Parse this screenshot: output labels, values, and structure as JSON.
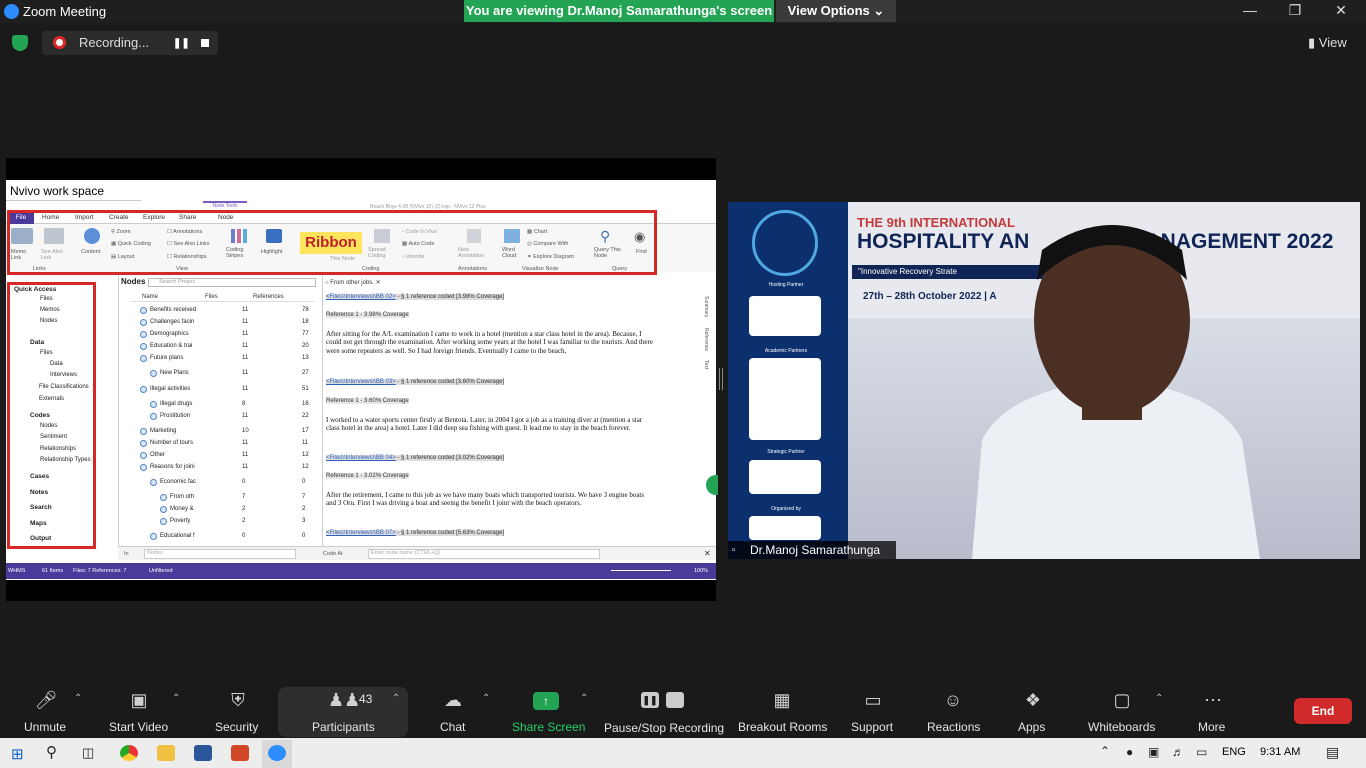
{
  "window": {
    "title": "Zoom Meeting",
    "viewing_banner": "You are viewing Dr.Manoj Samarathunga's screen",
    "view_options": "View Options"
  },
  "recording": {
    "label": "Recording...",
    "view_label": "View"
  },
  "nvivo": {
    "caption": "Nvivo work space",
    "window_title": "Beach Boys 4-28 (NVivo 12) (2).nvp - NVivo 12 Plus",
    "node_tools": "Node Tools",
    "tabs": [
      "File",
      "Home",
      "Import",
      "Create",
      "Explore",
      "Share",
      "Node"
    ],
    "ribbon_word": "Ribbon",
    "ribbon_items": {
      "memo_link": "Memo Link",
      "see_also_link": "See Also Link",
      "content": "Content",
      "zoom": "Zoom",
      "quick_coding": "Quick Coding",
      "layout": "Layout",
      "annotations": "Annotations",
      "see_also_links": "See Also Links",
      "relationships": "Relationships",
      "coding_stripes": "Coding Stripes",
      "highlight": "Highlight",
      "spread_coding": "Spread Coding",
      "code_in_vivo": "Code In Vivo",
      "auto_code": "Auto Code",
      "uncode": "Uncode",
      "new_annotation": "New Annotation",
      "word_cloud": "Word Cloud",
      "chart": "Chart",
      "compare_with": "Compare With",
      "explore_diagram": "Explore Diagram",
      "query_this_node": "Query This Node",
      "find": "Find",
      "this_node": "This Node"
    },
    "group_labels": [
      "Links",
      "View",
      "Coding",
      "Annotations",
      "Visualize Node",
      "Query"
    ],
    "nav": [
      {
        "label": "Quick Access",
        "head": true
      },
      {
        "label": "Files",
        "head": false
      },
      {
        "label": "Memos",
        "head": false
      },
      {
        "label": "Nodes",
        "head": false
      },
      {
        "label": "Data",
        "head": true
      },
      {
        "label": "Files",
        "head": false
      },
      {
        "label": "Data",
        "head": false
      },
      {
        "label": "Interviews",
        "head": false
      },
      {
        "label": "File Classifications",
        "head": false
      },
      {
        "label": "Externals",
        "head": false
      },
      {
        "label": "Codes",
        "head": true
      },
      {
        "label": "Nodes",
        "head": false
      },
      {
        "label": "Sentiment",
        "head": false
      },
      {
        "label": "Relationships",
        "head": false
      },
      {
        "label": "Relationship Types",
        "head": false
      },
      {
        "label": "Cases",
        "head": true
      },
      {
        "label": "Notes",
        "head": true
      },
      {
        "label": "Search",
        "head": true
      },
      {
        "label": "Maps",
        "head": true
      },
      {
        "label": "Output",
        "head": true
      }
    ],
    "nodes": {
      "title": "Nodes",
      "search_placeholder": "Search Project",
      "headers": [
        "Name",
        "Files",
        "References"
      ],
      "rows": [
        {
          "name": "Benefits received",
          "files": "11",
          "refs": "78"
        },
        {
          "name": "Challenges facin",
          "files": "11",
          "refs": "18"
        },
        {
          "name": "Demographics",
          "files": "11",
          "refs": "77"
        },
        {
          "name": "Education & trai",
          "files": "11",
          "refs": "20"
        },
        {
          "name": "Future plans",
          "files": "11",
          "refs": "13"
        },
        {
          "name": "New Plans",
          "files": "11",
          "refs": "27"
        },
        {
          "name": "Illegal activities",
          "files": "11",
          "refs": "51"
        },
        {
          "name": "Illegal drugs",
          "files": "8",
          "refs": "16"
        },
        {
          "name": "Prostitution",
          "files": "11",
          "refs": "22"
        },
        {
          "name": "Marketing",
          "files": "10",
          "refs": "17"
        },
        {
          "name": "Number of tours",
          "files": "11",
          "refs": "11"
        },
        {
          "name": "Other",
          "files": "11",
          "refs": "12"
        },
        {
          "name": "Reasons for joini",
          "files": "11",
          "refs": "12"
        },
        {
          "name": "Economic fac",
          "files": "0",
          "refs": "0"
        },
        {
          "name": "From oth",
          "files": "7",
          "refs": "7"
        },
        {
          "name": "Money &",
          "files": "2",
          "refs": "2"
        },
        {
          "name": "Poverty",
          "files": "2",
          "refs": "3"
        },
        {
          "name": "Educational f",
          "files": "0",
          "refs": "0"
        }
      ]
    },
    "doc": {
      "tab": "From other jobs.",
      "entries": [
        {
          "link": "<Files\\\\Interviews\\\\BB 02>",
          "coverage": " - § 1 reference coded  [3.98% Coverage]",
          "ref": "Reference 1 - 3.98% Coverage",
          "text": "After sitting for the A/L examination I came to work in a hotel (mention a star class hotel in the area). Because, I could not get through the examination. After working some years at the hotel I was familiar to the tourists. And there were some repeaters as well. So I had foreign friends. Eventually I came to the beach,"
        },
        {
          "link": "<Files\\\\Interviews\\\\BB 03>",
          "coverage": " - § 1 reference coded  [3.60% Coverage]",
          "ref": "Reference 1 - 3.60% Coverage",
          "text": "I worked to a water sports center firstly at Bentota. Later, in 2004 I got a job as a training diver at (mention a star class hotel in the area) a hotel. Later I did deep sea fishing with guest. It lead me to stay in the beach forever."
        },
        {
          "link": "<Files\\\\Interviews\\\\BB 04>",
          "coverage": " - § 1 reference coded  [3.02% Coverage]",
          "ref": "Reference 1 - 3.02% Coverage",
          "text": "After the retirement, I came to this job as we have many boats which transported tourists.  We have 3 engine boats and 3 Oru. First I was driving a boat and seeing the benefit I joint with the beach operators."
        },
        {
          "link": "<Files\\\\Interviews\\\\BB 07>",
          "coverage": " - § 1 reference coded  [5.63% Coverage]",
          "ref": "",
          "text": ""
        }
      ]
    },
    "side_tabs": [
      "Summary",
      "Reference",
      "Text"
    ],
    "code_at": {
      "in_label": "In",
      "nodes_placeholder": "Nodes",
      "code_at": "Code At",
      "node_placeholder": "Enter node name (CTRL+Q)"
    },
    "status": {
      "user": "WHMS",
      "items": "61 Items",
      "files_refs": "Files: 7  References: 7",
      "filter": "Unfiltered",
      "zoom": "100%"
    }
  },
  "webcam": {
    "name": "Dr.Manoj Samarathunga",
    "banner_top": "THE 9th INTERNATIONAL",
    "banner_title": "HOSPITALITY AN",
    "banner_title2": "MANAGEMENT 2022",
    "banner_sub": "\"Innovative Recovery Strate",
    "banner_date": "27th – 28th October 2022 | A",
    "poster_sections": [
      "Hosting Partner",
      "Academic Partners",
      "Strategic Partner",
      "Organized by"
    ]
  },
  "toolbar": {
    "unmute": "Unmute",
    "start_video": "Start Video",
    "security": "Security",
    "participants": "Participants",
    "participants_count": "43",
    "chat": "Chat",
    "share_screen": "Share Screen",
    "pause_stop": "Pause/Stop Recording",
    "breakout": "Breakout Rooms",
    "support": "Support",
    "reactions": "Reactions",
    "apps": "Apps",
    "whiteboards": "Whiteboards",
    "more": "More",
    "end": "End"
  },
  "taskbar": {
    "lang": "ENG",
    "time": "9:31 AM"
  },
  "colors": {
    "accent_green": "#23a455",
    "end_red": "#d02a2a",
    "nvivo_purple": "#4b3a9a",
    "highlight_red": "#d72828"
  }
}
